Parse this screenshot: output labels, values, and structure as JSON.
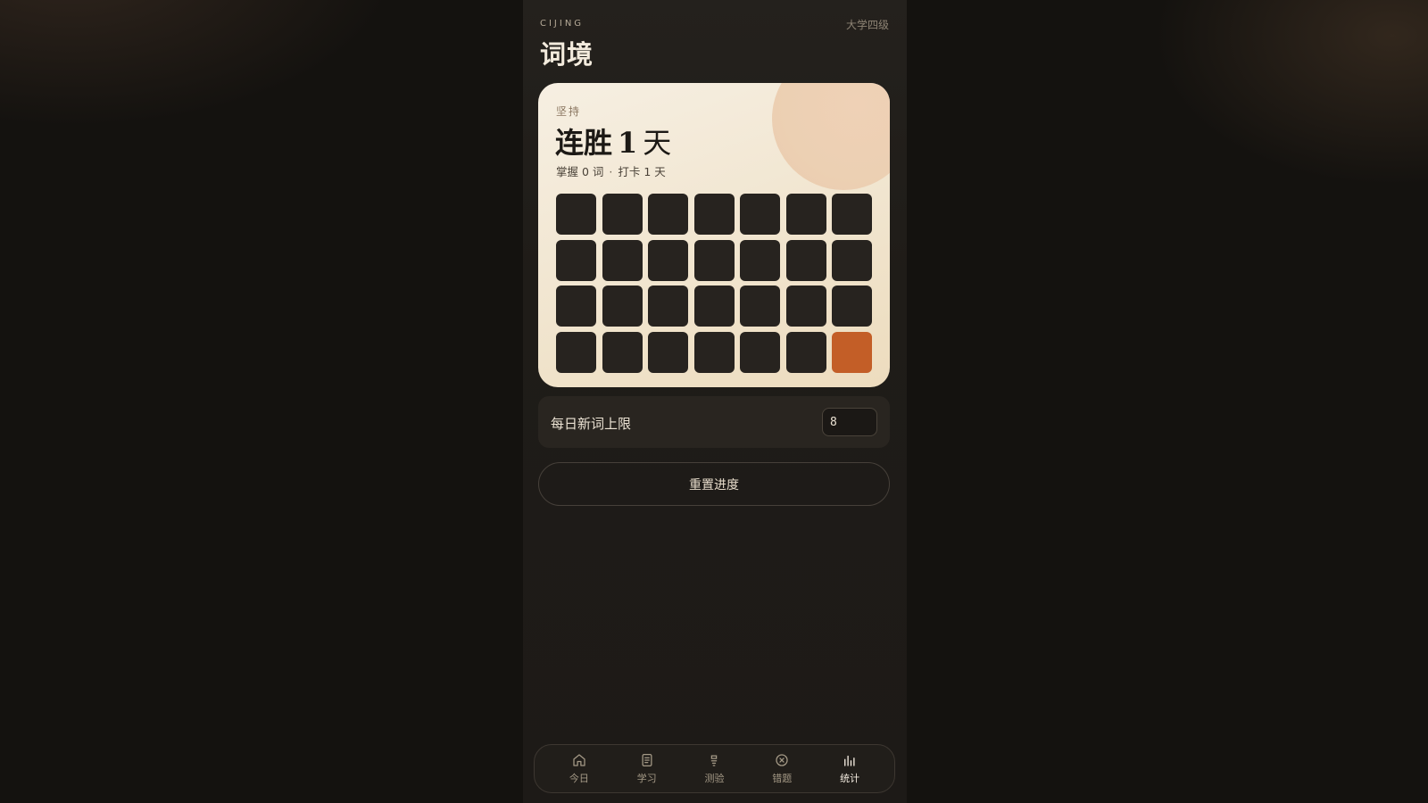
{
  "header": {
    "brand": "CIJING",
    "level": "大学四级",
    "title": "词境"
  },
  "streak_card": {
    "eyebrow": "坚持",
    "headline_prefix": "连胜",
    "streak_days": "1",
    "headline_unit": "天",
    "summary_mastered": "掌握 0 词",
    "summary_separator": "·",
    "summary_checkin": "打卡 1 天",
    "calendar": {
      "total_cells": 28,
      "active_cell_indices": [
        27
      ],
      "colors": {
        "inactive": "#27231f",
        "active": "#c35e27"
      }
    }
  },
  "settings": {
    "daily_limit_label": "每日新词上限",
    "daily_limit_value": "8"
  },
  "actions": {
    "reset_label": "重置进度"
  },
  "nav": {
    "items": [
      {
        "label": "今日",
        "icon": "home-icon",
        "active": false
      },
      {
        "label": "学习",
        "icon": "book-icon",
        "active": false
      },
      {
        "label": "测验",
        "icon": "quiz-icon",
        "active": false
      },
      {
        "label": "错题",
        "icon": "x-circle-icon",
        "active": false
      },
      {
        "label": "统计",
        "icon": "bar-chart-icon",
        "active": true
      }
    ]
  }
}
